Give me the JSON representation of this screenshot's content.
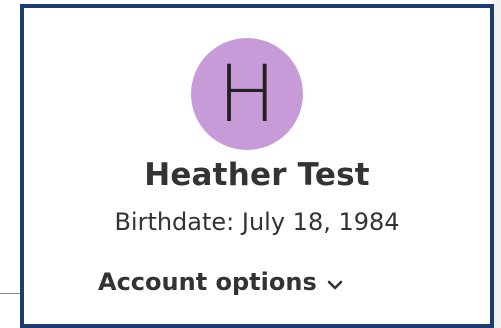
{
  "profile": {
    "avatar_initial": "H",
    "avatar_color": "#c79bd8",
    "name": "Heather Test",
    "birthdate": "Birthdate: July 18, 1984"
  },
  "menu": {
    "account_options_label": "Account options",
    "account_options_icon": "chevron-down-icon"
  },
  "colors": {
    "card_border": "#1c3b73",
    "text": "#333333"
  }
}
